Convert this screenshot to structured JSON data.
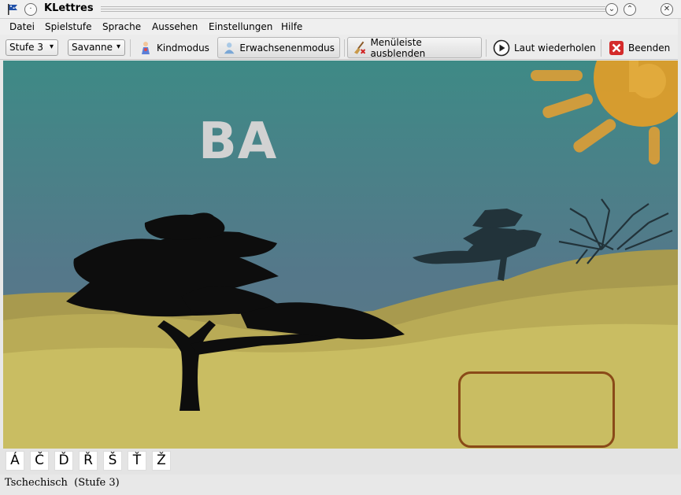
{
  "window": {
    "title": "KLettres"
  },
  "menubar": {
    "items": [
      "Datei",
      "Spielstufe",
      "Sprache",
      "Aussehen",
      "Einstellungen",
      "Hilfe"
    ]
  },
  "toolbar": {
    "level_combo": "Stufe 3",
    "theme_combo": "Savanne",
    "kid_mode": "Kindmodus",
    "grownup_mode": "Erwachsenenmodus",
    "hide_menubar": "Menüleiste ausblenden",
    "repeat": "Laut wiederholen",
    "quit": "Beenden"
  },
  "stage": {
    "syllable": "BA",
    "answer": ""
  },
  "special_chars": [
    "Á",
    "Č",
    "Ď",
    "Ř",
    "Š",
    "Ť",
    "Ž"
  ],
  "status": {
    "text": "Tschechisch  (Stufe 3)"
  },
  "colors": {
    "sky_top": "#3e8a86",
    "sky_bottom": "#5e7a84",
    "sand": "#c9bd62",
    "hills": "#a89a4e",
    "sun": "#f0a020",
    "answer_border": "#8a4a18",
    "syllable": "#d2d2d2"
  }
}
